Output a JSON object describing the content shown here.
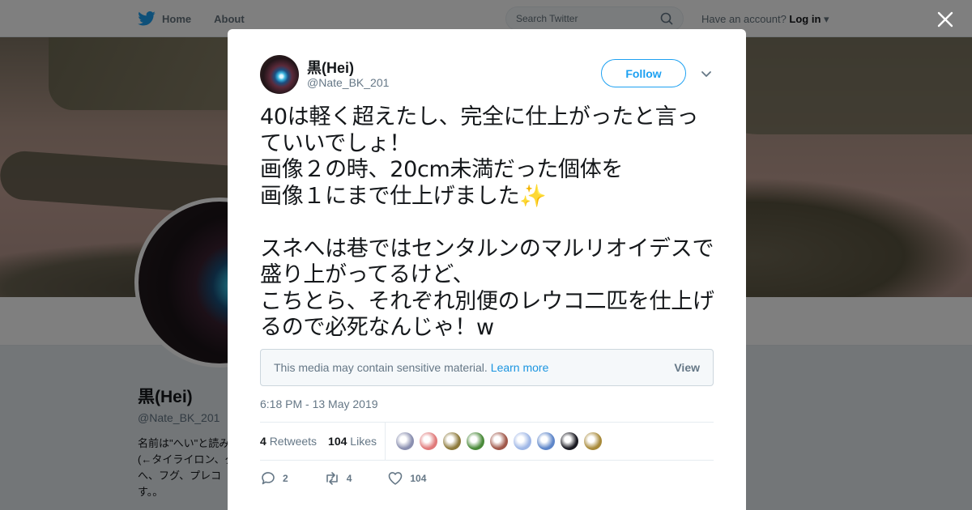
{
  "topbar": {
    "home_label": "Home",
    "about_label": "About",
    "search_placeholder": "Search Twitter",
    "account_prompt": "Have an account?",
    "login_label": "Log in"
  },
  "profile": {
    "name": "黒(Hei)",
    "handle": "@Nate_BK_201",
    "bio_visible": "名前は\"へい\"と読み\n(←タイライロン、ダ\nへ、フグ、プレコ\nす。。"
  },
  "tweet": {
    "author_name": "黒(Hei)",
    "author_handle": "@Nate_BK_201",
    "follow_label": "Follow",
    "text_part1": "40は軽く超えたし、完全に仕上がったと言っていいでしょ！\n画像２の時、20cm未満だった個体を\n画像１にまで仕上げました",
    "sparkle_emoji": "✨",
    "text_part2": "\n\nスネへは巷ではセンタルンのマルリオイデスで盛り上がってるけど、\nこちとら、それぞれ別便のレウコ二匹を仕上げるので必死なんじゃ！w",
    "sensitive_notice": "This media may contain sensitive material.",
    "learn_more_label": "Learn more",
    "view_label": "View",
    "timestamp": "6:18 PM - 13 May 2019",
    "retweets_count": "4",
    "retweets_label": "Retweets",
    "likes_count": "104",
    "likes_label": "Likes",
    "reply_count": "2",
    "retweet_action_count": "4",
    "like_action_count": "104"
  },
  "liker_avatars": [
    {
      "color": "#8a8fb0",
      "icon": "liker-avatar"
    },
    {
      "color": "#e07a7a",
      "icon": "liker-avatar"
    },
    {
      "color": "#8d7a3c",
      "icon": "liker-avatar"
    },
    {
      "color": "#4a8a3a",
      "icon": "liker-avatar"
    },
    {
      "color": "#a0584a",
      "icon": "liker-avatar"
    },
    {
      "color": "#9fb7e6",
      "icon": "liker-avatar"
    },
    {
      "color": "#5e86c9",
      "icon": "liker-avatar"
    },
    {
      "color": "#1a1a22",
      "icon": "liker-avatar"
    },
    {
      "color": "#a88a3a",
      "icon": "liker-avatar"
    }
  ],
  "colors": {
    "accent": "#1da1f2",
    "link": "#1b95e0",
    "secondary_text": "#657786"
  }
}
